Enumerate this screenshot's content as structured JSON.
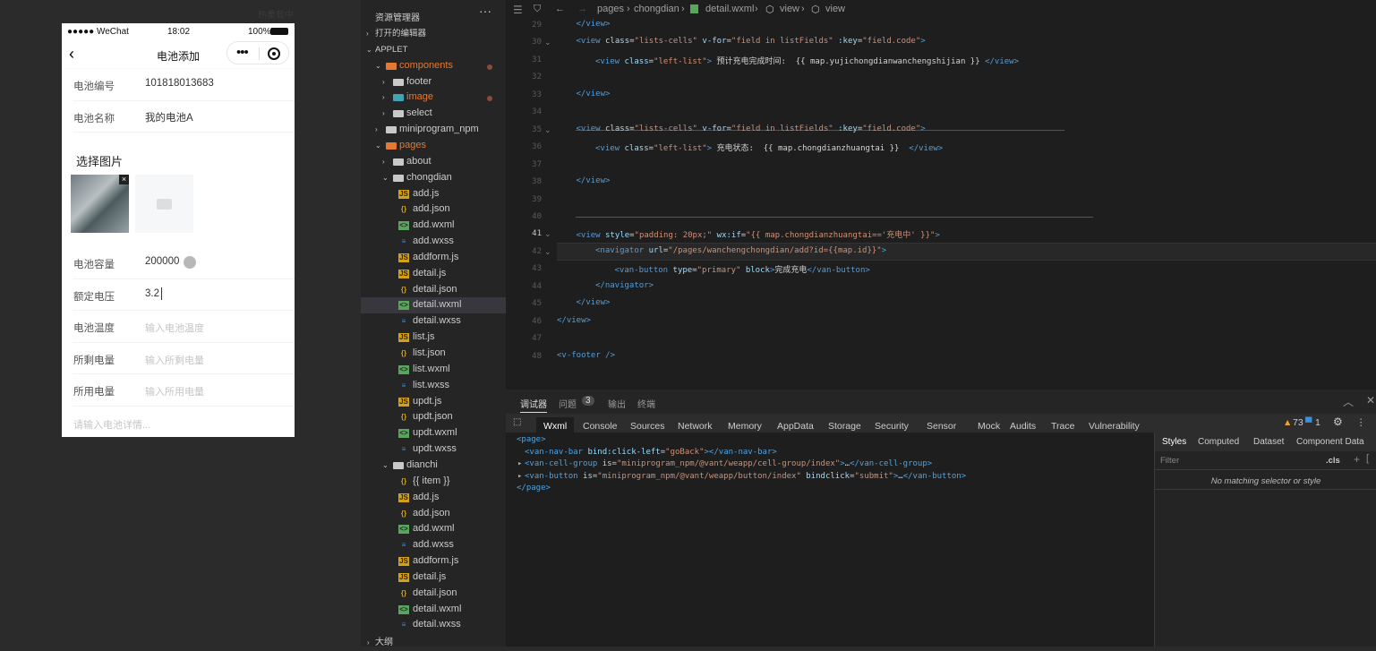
{
  "simulator": {
    "hot_label": "热重载中",
    "status": {
      "carrier": "●●●●● WeChat",
      "time": "18:02",
      "battery": "100%"
    },
    "nav": {
      "back": "‹",
      "title": "电池添加",
      "menu": "•••"
    },
    "cells_top": [
      {
        "label": "电池编号",
        "value": "101818013683"
      },
      {
        "label": "电池名称",
        "value": "我的电池A"
      }
    ],
    "section_title": "选择图片",
    "cells_bottom": [
      {
        "label": "电池容量",
        "value": "200000"
      },
      {
        "label": "额定电压",
        "value": "3.2"
      },
      {
        "label": "电池温度",
        "placeholder": "输入电池温度"
      },
      {
        "label": "所剩电量",
        "placeholder": "输入所剩电量"
      },
      {
        "label": "所用电量",
        "placeholder": "输入所用电量"
      }
    ],
    "textarea_placeholder": "请输入电池详情..."
  },
  "explorer": {
    "title": "资源管理器",
    "more": "···",
    "items": [
      {
        "label": "打开的编辑器",
        "kind": "section",
        "depth": 0,
        "arrow": "›"
      },
      {
        "label": "APPLET",
        "kind": "section",
        "depth": 0,
        "arrow": "⌄"
      },
      {
        "label": "components",
        "kind": "folder-red",
        "depth": 1,
        "arrow": "⌄",
        "modified": true
      },
      {
        "label": "footer",
        "kind": "folder",
        "depth": 2,
        "arrow": "›"
      },
      {
        "label": "image",
        "kind": "folder-teal",
        "depth": 2,
        "arrow": "›",
        "modified": true
      },
      {
        "label": "select",
        "kind": "folder",
        "depth": 2,
        "arrow": "›"
      },
      {
        "label": "miniprogram_npm",
        "kind": "folder",
        "depth": 1,
        "arrow": "›"
      },
      {
        "label": "pages",
        "kind": "folder-red",
        "depth": 1,
        "arrow": "⌄"
      },
      {
        "label": "about",
        "kind": "folder",
        "depth": 2,
        "arrow": "›"
      },
      {
        "label": "chongdian",
        "kind": "folder",
        "depth": 2,
        "arrow": "⌄"
      },
      {
        "label": "add.js",
        "kind": "js",
        "depth": 3
      },
      {
        "label": "add.json",
        "kind": "json",
        "depth": 3
      },
      {
        "label": "add.wxml",
        "kind": "wxml",
        "depth": 3
      },
      {
        "label": "add.wxss",
        "kind": "wxss",
        "depth": 3
      },
      {
        "label": "addform.js",
        "kind": "js",
        "depth": 3
      },
      {
        "label": "detail.js",
        "kind": "js",
        "depth": 3
      },
      {
        "label": "detail.json",
        "kind": "json",
        "depth": 3
      },
      {
        "label": "detail.wxml",
        "kind": "wxml",
        "depth": 3,
        "selected": true
      },
      {
        "label": "detail.wxss",
        "kind": "wxss",
        "depth": 3
      },
      {
        "label": "list.js",
        "kind": "js",
        "depth": 3
      },
      {
        "label": "list.json",
        "kind": "json",
        "depth": 3
      },
      {
        "label": "list.wxml",
        "kind": "wxml",
        "depth": 3
      },
      {
        "label": "list.wxss",
        "kind": "wxss",
        "depth": 3
      },
      {
        "label": "updt.js",
        "kind": "js",
        "depth": 3
      },
      {
        "label": "updt.json",
        "kind": "json",
        "depth": 3
      },
      {
        "label": "updt.wxml",
        "kind": "wxml",
        "depth": 3
      },
      {
        "label": "updt.wxss",
        "kind": "wxss",
        "depth": 3
      },
      {
        "label": "dianchi",
        "kind": "folder",
        "depth": 2,
        "arrow": "⌄"
      },
      {
        "label": "{{ item }}",
        "kind": "json",
        "depth": 3
      },
      {
        "label": "add.js",
        "kind": "js",
        "depth": 3
      },
      {
        "label": "add.json",
        "kind": "json",
        "depth": 3
      },
      {
        "label": "add.wxml",
        "kind": "wxml",
        "depth": 3
      },
      {
        "label": "add.wxss",
        "kind": "wxss",
        "depth": 3
      },
      {
        "label": "addform.js",
        "kind": "js",
        "depth": 3
      },
      {
        "label": "detail.js",
        "kind": "js",
        "depth": 3
      },
      {
        "label": "detail.json",
        "kind": "json",
        "depth": 3
      },
      {
        "label": "detail.wxml",
        "kind": "wxml",
        "depth": 3
      },
      {
        "label": "detail.wxss",
        "kind": "wxss",
        "depth": 3
      }
    ],
    "outline": "大纲"
  },
  "editor": {
    "breadcrumb": [
      "pages",
      "chongdian",
      "detail.wxml",
      "view",
      "view"
    ],
    "lines": [
      {
        "n": "29",
        "indent": 1,
        "parts": [
          [
            "tag",
            "</view>"
          ]
        ]
      },
      {
        "n": "30",
        "indent": 1,
        "parts": [
          [
            "tag",
            "<view "
          ],
          [
            "kw",
            "class"
          ],
          [
            "",
            "="
          ],
          [
            "str",
            "\"lists-cells\""
          ],
          [
            "kw",
            " v-for"
          ],
          [
            "",
            "="
          ],
          [
            "str",
            "\"field in listFields\""
          ],
          [
            "kw",
            " :key"
          ],
          [
            "",
            "="
          ],
          [
            "str",
            "\"field.code\""
          ],
          [
            "tag",
            ">"
          ]
        ]
      },
      {
        "n": "31",
        "indent": 2,
        "parts": [
          [
            "tag",
            "<view "
          ],
          [
            "kw",
            "class"
          ],
          [
            "",
            "="
          ],
          [
            "str",
            "\"left-list\""
          ],
          [
            "tag",
            ">"
          ],
          [
            "",
            " 预计充电完成时间:  {{ map.yujichongdianwanchengshijian }} "
          ],
          [
            "tag",
            "</view>"
          ]
        ]
      },
      {
        "n": "32",
        "indent": 0,
        "parts": []
      },
      {
        "n": "33",
        "indent": 1,
        "parts": [
          [
            "tag",
            "</view>"
          ]
        ]
      },
      {
        "n": "34",
        "indent": 0,
        "parts": []
      },
      {
        "n": "35",
        "indent": 1,
        "parts": [
          [
            "tag",
            "<view "
          ],
          [
            "kw",
            "class"
          ],
          [
            "",
            "="
          ],
          [
            "str",
            "\"lists-cells\""
          ],
          [
            "kw",
            " v-for"
          ],
          [
            "",
            "="
          ],
          [
            "str",
            "\"field in listFields\""
          ],
          [
            "kw",
            " :key"
          ],
          [
            "",
            "="
          ],
          [
            "str",
            "\"field.code\""
          ],
          [
            "tag",
            ">"
          ]
        ]
      },
      {
        "n": "36",
        "indent": 2,
        "parts": [
          [
            "tag",
            "<view "
          ],
          [
            "kw",
            "class"
          ],
          [
            "",
            "="
          ],
          [
            "str",
            "\"left-list\""
          ],
          [
            "tag",
            ">"
          ],
          [
            "",
            " 充电状态:  {{ map.chongdianzhuangtai }}  "
          ],
          [
            "tag",
            "</view>"
          ]
        ]
      },
      {
        "n": "37",
        "indent": 0,
        "parts": []
      },
      {
        "n": "38",
        "indent": 1,
        "parts": [
          [
            "tag",
            "</view>"
          ]
        ]
      },
      {
        "n": "39",
        "indent": 0,
        "parts": []
      },
      {
        "n": "40",
        "indent": 0,
        "parts": []
      },
      {
        "n": "41",
        "indent": 1,
        "parts": [
          [
            "tag",
            "<view "
          ],
          [
            "kw",
            "style"
          ],
          [
            "",
            "="
          ],
          [
            "str",
            "\"padding: 20px;\""
          ],
          [
            "kw",
            " wx:if"
          ],
          [
            "",
            "="
          ],
          [
            "str",
            "\"{{ map.chongdianzhuangtai=='充电中' }}\""
          ],
          [
            "tag",
            ">"
          ]
        ]
      },
      {
        "n": "42",
        "indent": 2,
        "parts": [
          [
            "tag",
            "<navigator "
          ],
          [
            "kw",
            "url"
          ],
          [
            "",
            "="
          ],
          [
            "str",
            "\"/pages/wanchengchongdian/add?id={{map.id}}\""
          ],
          [
            "tag",
            ">"
          ]
        ]
      },
      {
        "n": "43",
        "indent": 3,
        "parts": [
          [
            "tag",
            "<van-button "
          ],
          [
            "kw",
            "type"
          ],
          [
            "",
            "="
          ],
          [
            "str",
            "\"primary\""
          ],
          [
            "kw",
            " block"
          ],
          [
            "tag",
            ">"
          ],
          [
            "",
            "完成充电"
          ],
          [
            "tag",
            "</van-button>"
          ]
        ]
      },
      {
        "n": "44",
        "indent": 2,
        "parts": [
          [
            "tag",
            "</navigator>"
          ]
        ]
      },
      {
        "n": "45",
        "indent": 1,
        "parts": [
          [
            "tag",
            "</view>"
          ]
        ]
      },
      {
        "n": "46",
        "indent": 0,
        "parts": [
          [
            "tag",
            "</view>"
          ]
        ]
      },
      {
        "n": "47",
        "indent": 0,
        "parts": []
      },
      {
        "n": "48",
        "indent": 0,
        "parts": [
          [
            "tag",
            "<v-footer />"
          ]
        ]
      }
    ]
  },
  "panel": {
    "tabs": [
      "调试器",
      "问题",
      "输出",
      "终端"
    ],
    "problem_count": "3",
    "devtabs": [
      "Wxml",
      "Console",
      "Sources",
      "Network",
      "Memory",
      "AppData",
      "Storage",
      "Security",
      "Sensor",
      "Mock",
      "Audits",
      "Trace",
      "Vulnerability"
    ],
    "warn_count": "73",
    "info_count": "1",
    "tree": [
      {
        "indent": 0,
        "arrow": "",
        "parts": [
          [
            "tag",
            "<page>"
          ]
        ]
      },
      {
        "indent": 1,
        "arrow": "",
        "parts": [
          [
            "tag",
            "<van-nav-bar "
          ],
          [
            "kw",
            "bind:click-left"
          ],
          [
            "",
            "="
          ],
          [
            "str",
            "\"goBack\""
          ],
          [
            "tag",
            "></van-nav-bar>"
          ]
        ]
      },
      {
        "indent": 1,
        "arrow": "▸",
        "parts": [
          [
            "tag",
            "<van-cell-group "
          ],
          [
            "kw",
            "is"
          ],
          [
            "",
            "="
          ],
          [
            "str",
            "\"miniprogram_npm/@vant/weapp/cell-group/index\""
          ],
          [
            "tag",
            ">"
          ],
          [
            "",
            "…"
          ],
          [
            "tag",
            "</van-cell-group>"
          ]
        ]
      },
      {
        "indent": 1,
        "arrow": "▸",
        "parts": [
          [
            "tag",
            "<van-button "
          ],
          [
            "kw",
            "is"
          ],
          [
            "",
            "="
          ],
          [
            "str",
            "\"miniprogram_npm/@vant/weapp/button/index\""
          ],
          [
            "kw",
            " bindclick"
          ],
          [
            "",
            "="
          ],
          [
            "str",
            "\"submit\""
          ],
          [
            "tag",
            ">"
          ],
          [
            "",
            "…"
          ],
          [
            "tag",
            "</van-button>"
          ]
        ]
      },
      {
        "indent": 0,
        "arrow": "",
        "parts": [
          [
            "tag",
            "</page>"
          ]
        ]
      }
    ],
    "style_tabs": [
      "Styles",
      "Computed",
      "Dataset",
      "Component Data"
    ],
    "filter_placeholder": "Filter",
    "cls": ".cls",
    "no_match": "No matching selector or style"
  },
  "colors": {
    "accent": "#e37933",
    "selected": "#37373d"
  }
}
